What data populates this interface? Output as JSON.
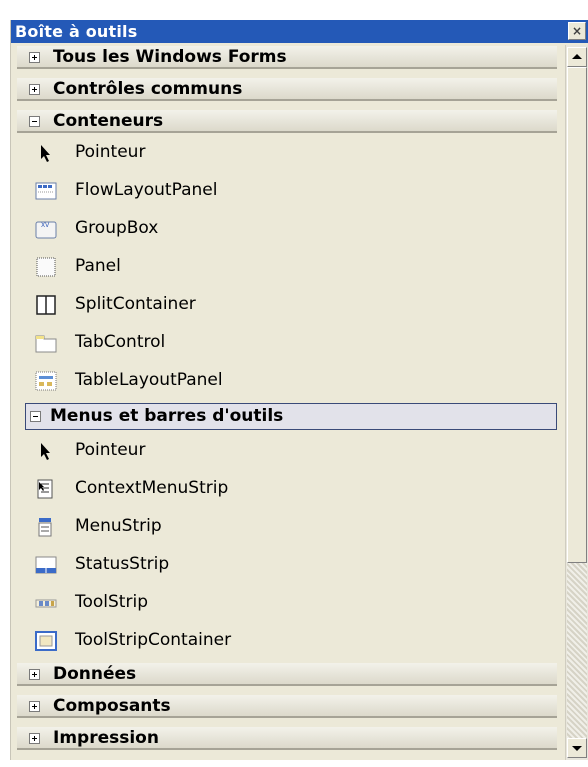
{
  "window": {
    "title": "Boîte à outils",
    "close_glyph": "×"
  },
  "categories": {
    "all_forms": "Tous les Windows Forms",
    "common": "Contrôles communs",
    "containers": "Conteneurs",
    "menus": "Menus et barres d'outils",
    "data": "Données",
    "components": "Composants",
    "printing": "Impression"
  },
  "containers_items": [
    "Pointeur",
    "FlowLayoutPanel",
    "GroupBox",
    "Panel",
    "SplitContainer",
    "TabControl",
    "TableLayoutPanel"
  ],
  "menus_items": [
    "Pointeur",
    "ContextMenuStrip",
    "MenuStrip",
    "StatusStrip",
    "ToolStrip",
    "ToolStripContainer"
  ]
}
